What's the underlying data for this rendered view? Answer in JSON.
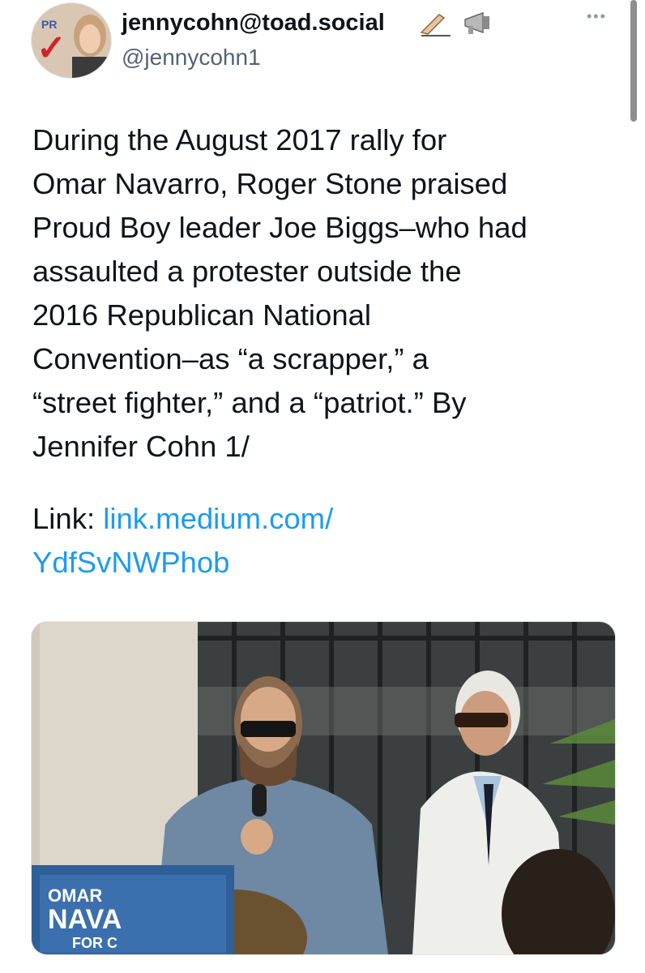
{
  "author": {
    "display_name": "jennycohn@toad.social",
    "handle": "@jennycohn1",
    "name_emojis": [
      "✍🏻",
      "📢"
    ],
    "avatar_sign_text": "PR"
  },
  "tweet": {
    "text_lines": [
      "During the August 2017 rally for",
      "Omar Navarro, Roger Stone praised",
      "Proud Boy leader Joe Biggs–who had",
      "assaulted a protester outside the",
      "2016 Republican National",
      "Convention–as “a scrapper,” a",
      "“street fighter,” and a “patriot.” By",
      "Jennifer Cohn 1/"
    ],
    "link_label": "Link: ",
    "link_text_line1": "link.medium.com/",
    "link_text_line2": "YdfSvNWPhob"
  },
  "media": {
    "sign_text": [
      "OMAR",
      "NAVA",
      "FOR C"
    ]
  },
  "icons": {
    "more": "more-horizontal-icon"
  },
  "colors": {
    "link": "#1d9bf0",
    "text": "#0f1419",
    "secondary": "#536471"
  }
}
